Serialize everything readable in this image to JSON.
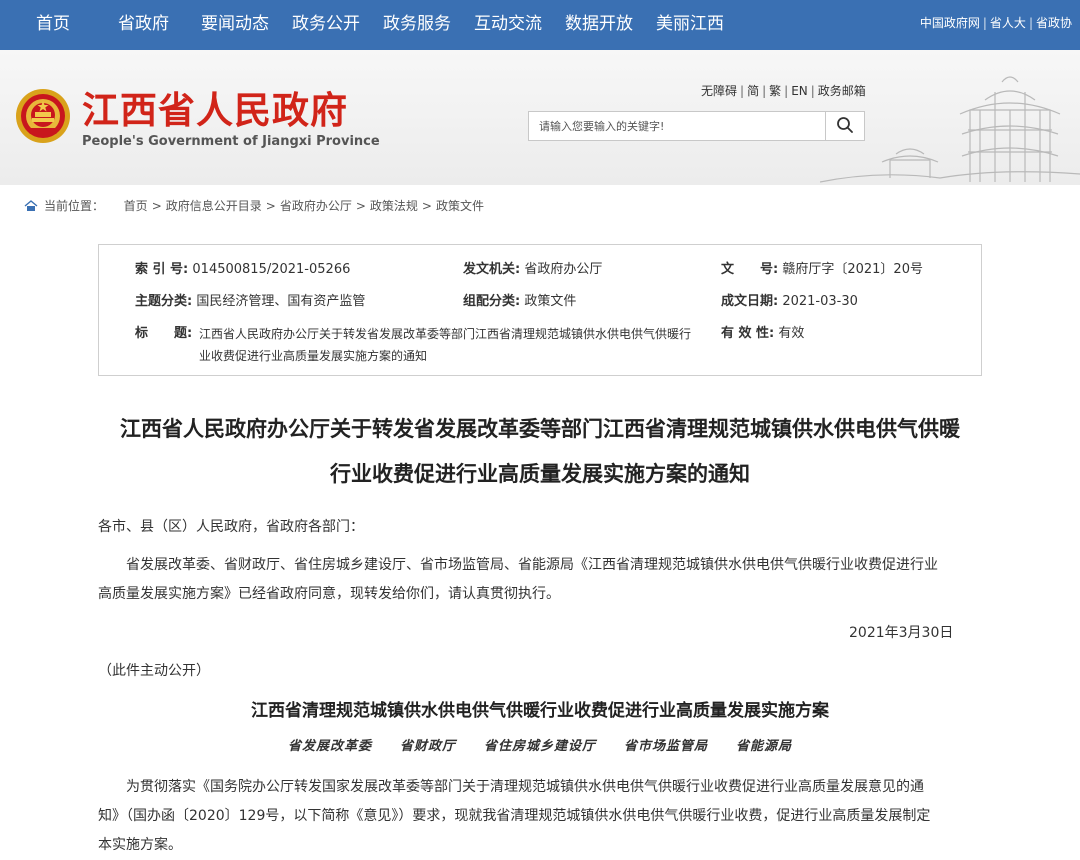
{
  "nav": {
    "items": [
      "首页",
      "省政府",
      "要闻动态",
      "政务公开",
      "政务服务",
      "互动交流",
      "数据开放",
      "美丽江西"
    ],
    "right_links": [
      "中国政府网",
      "省人大",
      "省政协"
    ]
  },
  "header": {
    "site_name": "江西省人民政府",
    "site_name_en": "People's Government of Jiangxi Province",
    "util_links": [
      "无障碍",
      "简",
      "繁",
      "EN",
      "政务邮箱"
    ],
    "search_placeholder": "请输入您要输入的关键字!",
    "search_icon": "search-icon"
  },
  "breadcrumb": {
    "label": "当前位置：",
    "items": [
      "首页",
      "政府信息公开目录",
      "省政府办公厅",
      "政策法规",
      "政策文件"
    ],
    "separator": ">"
  },
  "meta": {
    "index_label": "索 引 号:",
    "index_value": "014500815/2021-05266",
    "issuer_label": "发文机关:",
    "issuer_value": "省政府办公厅",
    "docno_label": "文　　号:",
    "docno_value": "赣府厅字〔2021〕20号",
    "topic_label": "主题分类:",
    "topic_value": "国民经济管理、国有资产监管",
    "category_label": "组配分类:",
    "category_value": "政策文件",
    "date_label": "成文日期:",
    "date_value": "2021-03-30",
    "title_label": "标　　题:",
    "title_value": "江西省人民政府办公厅关于转发省发展改革委等部门江西省清理规范城镇供水供电供气供暖行业收费促进行业高质量发展实施方案的通知",
    "validity_label": "有 效 性:",
    "validity_value": "有效"
  },
  "doc": {
    "title_line1": "江西省人民政府办公厅关于转发省发展改革委等部门江西省清理规范城镇供水供电供气供暖",
    "title_line2": "行业收费促进行业高质量发展实施方案的通知",
    "salutation": "各市、县（区）人民政府，省政府各部门：",
    "para1_line1": "省发展改革委、省财政厅、省住房城乡建设厅、省市场监管局、省能源局《江西省清理规范城镇供水供电供气供暖行业收费促进行业",
    "para1_line2": "高质量发展实施方案》已经省政府同意，现转发给你们，请认真贯彻执行。",
    "date": "2021年3月30日",
    "disclosure": "（此件主动公开）",
    "sub_title": "江西省清理规范城镇供水供电供气供暖行业收费促进行业高质量发展实施方案",
    "issuers": "省发展改革委　　省财政厅　　省住房城乡建设厅　　省市场监管局　　省能源局",
    "para2_line1": "为贯彻落实《国务院办公厅转发国家发展改革委等部门关于清理规范城镇供水供电供气供暖行业收费促进行业高质量发展意见的通",
    "para2_line2": "知》（国办函〔2020〕129号，以下简称《意见》）要求，现就我省清理规范城镇供水供电供气供暖行业收费，促进行业高质量发展制定",
    "para2_line3": "本实施方案。"
  }
}
